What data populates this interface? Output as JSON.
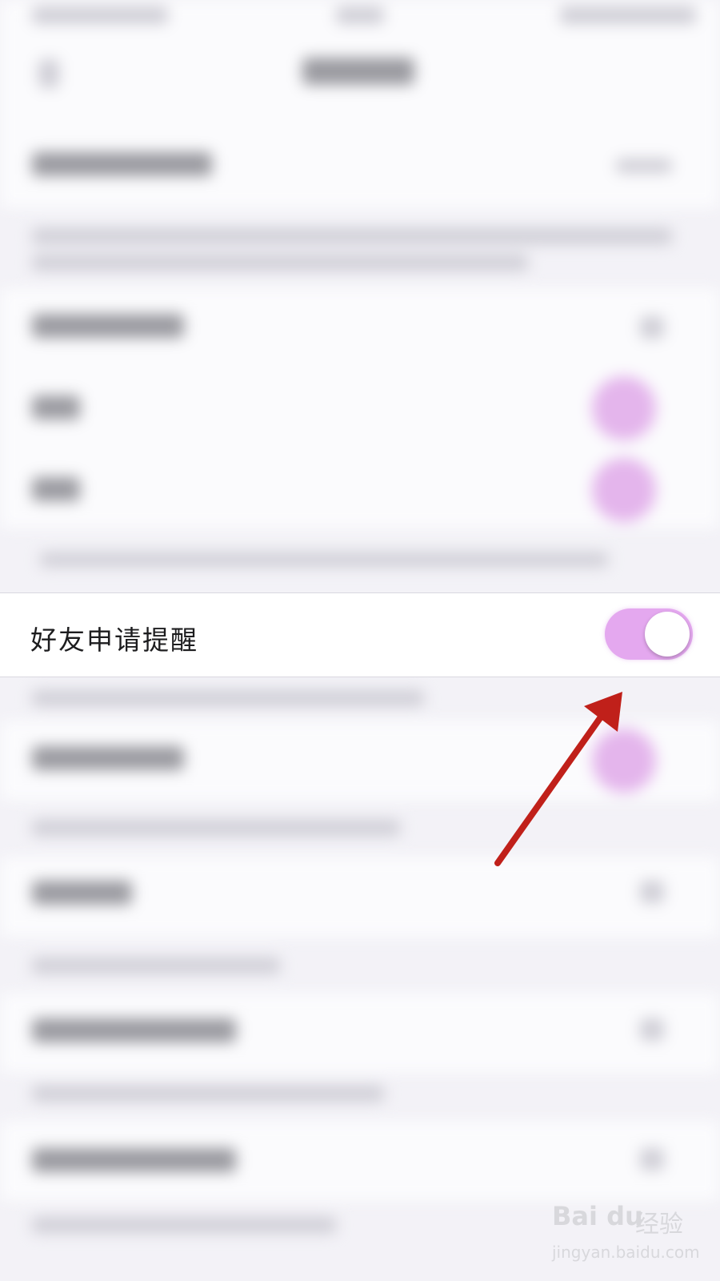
{
  "setting": {
    "label": "好友申请提醒",
    "enabled": true
  },
  "colors": {
    "toggle_on": "#e4a8ef",
    "arrow": "#c0201a",
    "background": "#f3f2f7"
  },
  "watermark": {
    "logo": "Bai du",
    "text": "经验",
    "url": "jingyan.baidu.com"
  }
}
